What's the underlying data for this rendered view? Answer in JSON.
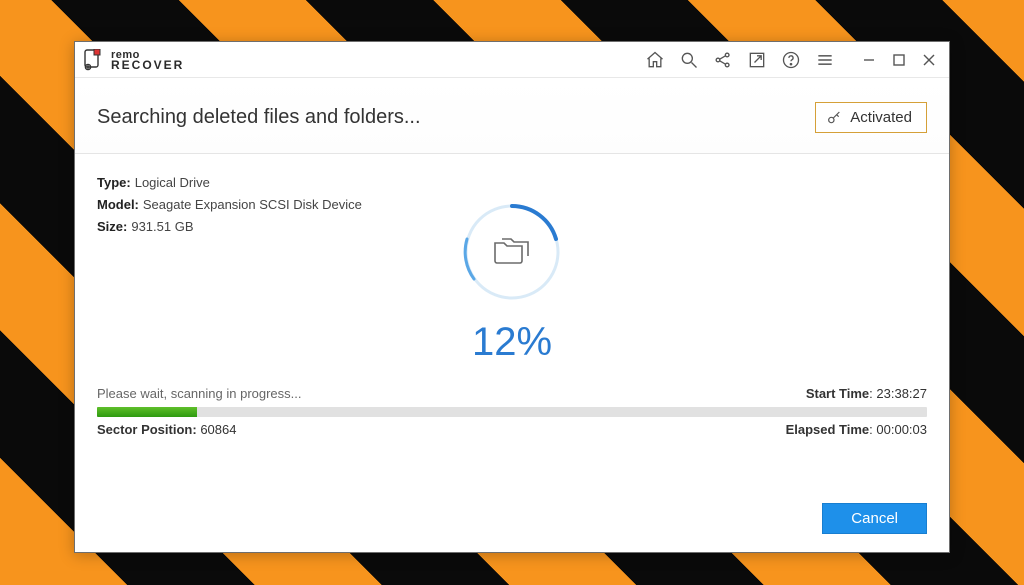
{
  "app": {
    "name_line1": "remo",
    "name_line2": "RECOVER"
  },
  "titlebar_icons": {
    "home": "home-icon",
    "search": "search-icon",
    "share": "share-icon",
    "export": "arrow-out-icon",
    "help": "help-icon",
    "menu": "menu-icon"
  },
  "header": {
    "title": "Searching deleted files and folders...",
    "activated_label": "Activated"
  },
  "drive": {
    "type_label": "Type:",
    "type_value": "Logical Drive",
    "model_label": "Model:",
    "model_value": "Seagate Expansion SCSI Disk Device",
    "size_label": "Size:",
    "size_value": "931.51 GB"
  },
  "progress": {
    "percent": "12%",
    "percent_value": 12,
    "wait_text": "Please wait, scanning in progress...",
    "start_label": "Start Time",
    "start_value": "23:38:27",
    "sector_label": "Sector Position:",
    "sector_value": "60864",
    "elapsed_label": "Elapsed Time",
    "elapsed_value": "00:00:03"
  },
  "buttons": {
    "cancel": "Cancel"
  }
}
